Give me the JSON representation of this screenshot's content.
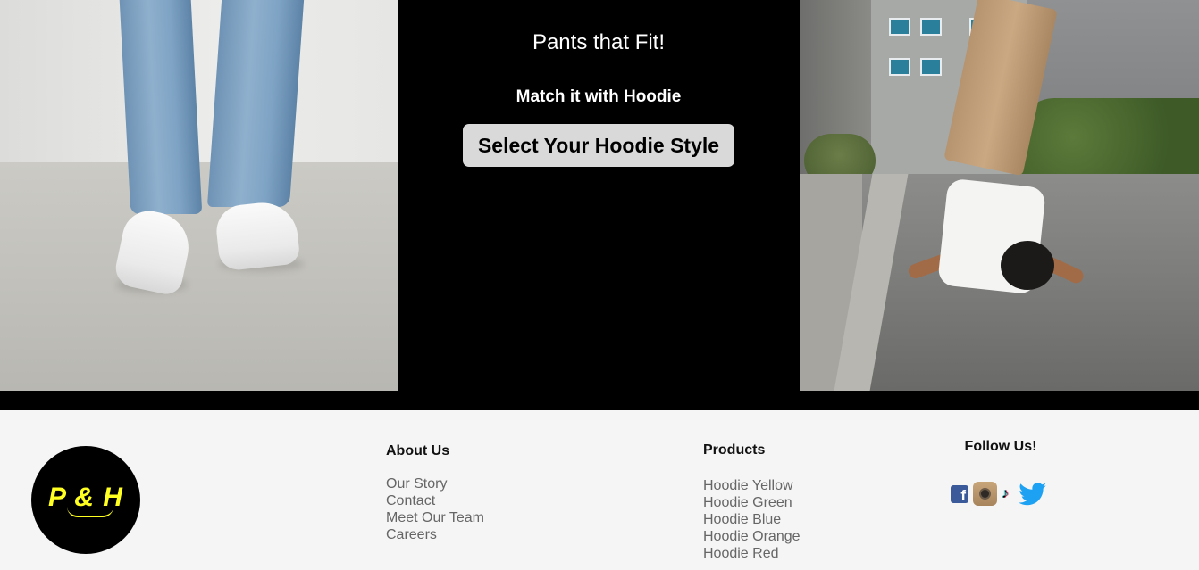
{
  "hero": {
    "title": "Pants that Fit!",
    "subtitle": "Match it with Hoodie",
    "cta_label": "Select Your Hoodie Style"
  },
  "footer": {
    "logo_text": "P & H",
    "about": {
      "heading": "About Us",
      "links": [
        "Our Story",
        "Contact",
        "Meet Our Team",
        "Careers"
      ]
    },
    "products": {
      "heading": "Products",
      "links": [
        "Hoodie Yellow",
        "Hoodie Green",
        "Hoodie Blue",
        "Hoodie Orange",
        "Hoodie Red"
      ]
    },
    "follow": {
      "heading": "Follow Us!",
      "icons": [
        "facebook-icon",
        "instagram-icon",
        "tiktok-icon",
        "twitter-icon"
      ]
    }
  },
  "colors": {
    "hero_bg": "#000000",
    "cta_bg": "#d9d9d9",
    "footer_bg": "#f5f5f5",
    "logo_text": "#ffff22",
    "link": "#666666"
  }
}
